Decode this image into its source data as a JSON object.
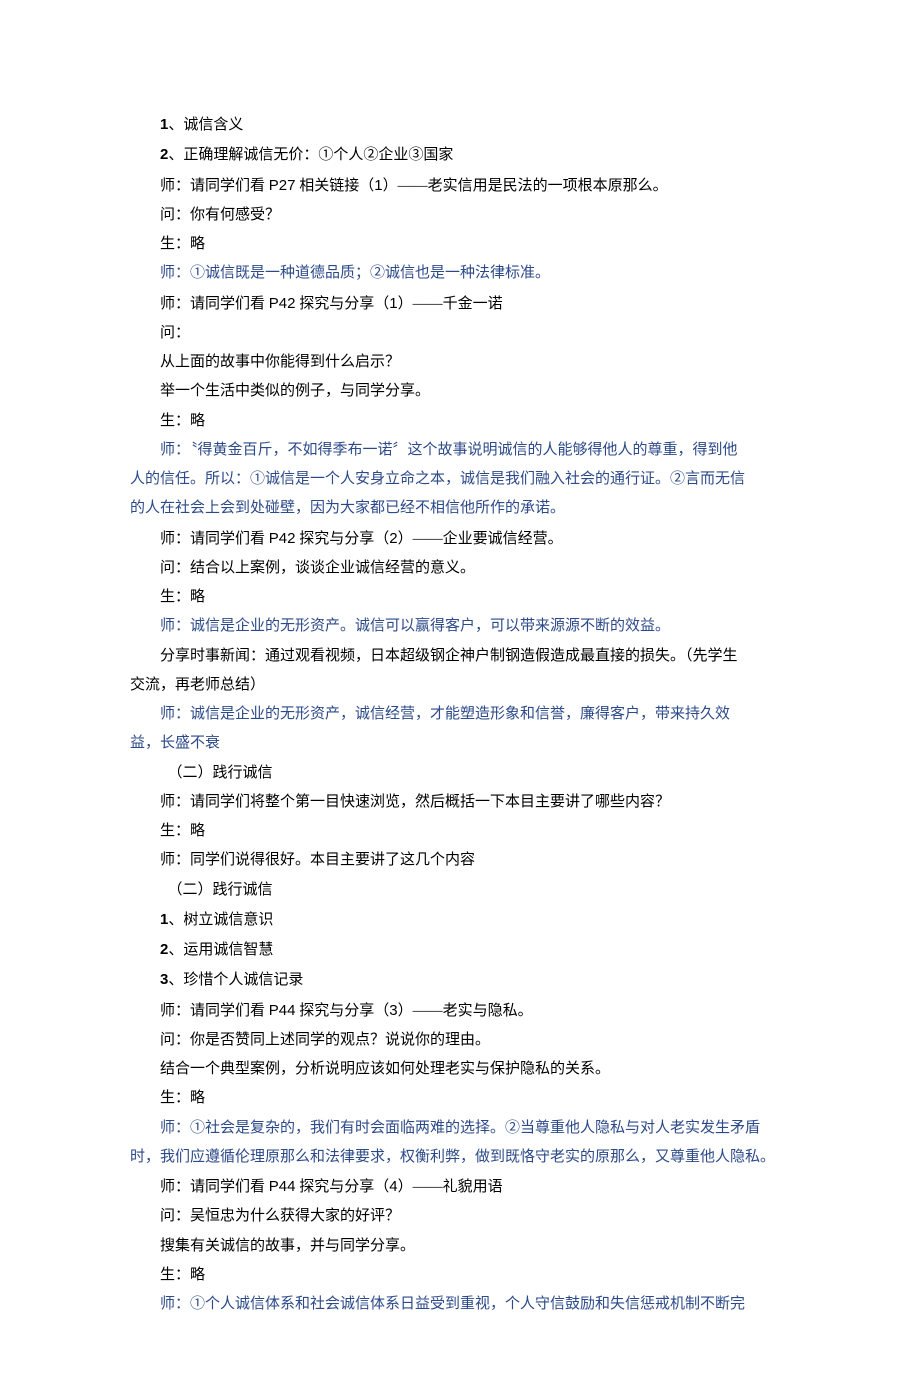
{
  "lines": [
    {
      "cls": "para",
      "segs": [
        {
          "t": "1",
          "c": "bold-num"
        },
        {
          "t": "、诚信含义"
        }
      ]
    },
    {
      "cls": "para",
      "segs": [
        {
          "t": "2",
          "c": "bold-num"
        },
        {
          "t": "、正确理解诚信无价：①个人②企业③国家"
        }
      ]
    },
    {
      "cls": "para",
      "segs": [
        {
          "t": "师：请同学们看 "
        },
        {
          "t": "P27",
          "c": "latin"
        },
        {
          "t": " 相关链接（"
        },
        {
          "t": "1",
          "c": "latin"
        },
        {
          "t": "）"
        },
        {
          "t": "——",
          "c": "dash"
        },
        {
          "t": "老实信用是民法的一项根本原那么。"
        }
      ]
    },
    {
      "cls": "para",
      "segs": [
        {
          "t": "问：你有何感受？"
        }
      ]
    },
    {
      "cls": "para",
      "segs": [
        {
          "t": "生：略"
        }
      ]
    },
    {
      "cls": "para blue",
      "segs": [
        {
          "t": "师：①诚信既是一种道德品质；②诚信也是一种法律标准。"
        }
      ]
    },
    {
      "cls": "para",
      "segs": [
        {
          "t": "师：请同学们看 "
        },
        {
          "t": "P42",
          "c": "latin"
        },
        {
          "t": " 探究与分享（"
        },
        {
          "t": "1",
          "c": "latin"
        },
        {
          "t": "）"
        },
        {
          "t": "——",
          "c": "dash"
        },
        {
          "t": "千金一诺"
        }
      ]
    },
    {
      "cls": "para",
      "segs": [
        {
          "t": "问："
        }
      ]
    },
    {
      "cls": "para",
      "segs": [
        {
          "t": "从上面的故事中你能得到什么启示？"
        }
      ]
    },
    {
      "cls": "para",
      "segs": [
        {
          "t": "举一个生活中类似的例子，与同学分享。"
        }
      ]
    },
    {
      "cls": "para",
      "segs": [
        {
          "t": "生：略"
        }
      ]
    },
    {
      "cls": "para blue",
      "segs": [
        {
          "t": "师：〝得黄金百斤，不如得季布一诺〞这个故事说明诚信的人能够得他人的尊重，得到他"
        }
      ]
    },
    {
      "cls": "blue",
      "segs": [
        {
          "t": "人的信任。所以：①诚信是一个人安身立命之本，诚信是我们融入社会的通行证。②言而无信"
        }
      ]
    },
    {
      "cls": "blue",
      "segs": [
        {
          "t": "的人在社会上会到处碰壁，因为大家都已经不相信他所作的承诺。"
        }
      ]
    },
    {
      "cls": "para",
      "segs": [
        {
          "t": "师：请同学们看 "
        },
        {
          "t": "P42",
          "c": "latin"
        },
        {
          "t": " 探究与分享（"
        },
        {
          "t": "2",
          "c": "latin"
        },
        {
          "t": "）"
        },
        {
          "t": "——",
          "c": "dash"
        },
        {
          "t": "企业要诚信经营。"
        }
      ]
    },
    {
      "cls": "para",
      "segs": [
        {
          "t": "问：结合以上案例，谈谈企业诚信经营的意义。"
        }
      ]
    },
    {
      "cls": "para",
      "segs": [
        {
          "t": "生：略"
        }
      ]
    },
    {
      "cls": "para blue",
      "segs": [
        {
          "t": "师：诚信是企业的无形资产。诚信可以赢得客户，可以带来源源不断的效益。"
        }
      ]
    },
    {
      "cls": "para",
      "segs": [
        {
          "t": "分享时事新闻：通过观看视频，日本超级钢企神户制钢造假造成最直接的损失。（先学生"
        }
      ]
    },
    {
      "cls": "",
      "segs": [
        {
          "t": "交流，再老师总结）"
        }
      ]
    },
    {
      "cls": "para blue",
      "segs": [
        {
          "t": "师：诚信是企业的无形资产，诚信经营，才能塑造形象和信誉，廉得客户，带来持久效"
        }
      ]
    },
    {
      "cls": "blue",
      "segs": [
        {
          "t": "益，长盛不衰"
        }
      ]
    },
    {
      "cls": "para",
      "segs": [
        {
          "t": "　（二）践行诚信"
        }
      ]
    },
    {
      "cls": "para",
      "segs": [
        {
          "t": "师：请同学们将整个第一目快速浏览，然后概括一下本目主要讲了哪些内容？"
        }
      ]
    },
    {
      "cls": "para",
      "segs": [
        {
          "t": "生：略"
        }
      ]
    },
    {
      "cls": "para",
      "segs": [
        {
          "t": "师：同学们说得很好。本目主要讲了这几个内容"
        }
      ]
    },
    {
      "cls": "para",
      "segs": [
        {
          "t": "　（二）践行诚信"
        }
      ]
    },
    {
      "cls": "para",
      "segs": [
        {
          "t": "1",
          "c": "bold-num"
        },
        {
          "t": "、树立诚信意识"
        }
      ]
    },
    {
      "cls": "para",
      "segs": [
        {
          "t": "2",
          "c": "bold-num"
        },
        {
          "t": "、运用诚信智慧"
        }
      ]
    },
    {
      "cls": "para",
      "segs": [
        {
          "t": "3",
          "c": "bold-num"
        },
        {
          "t": "、珍惜个人诚信记录"
        }
      ]
    },
    {
      "cls": "para",
      "segs": [
        {
          "t": "师：请同学们看 "
        },
        {
          "t": "P44",
          "c": "latin"
        },
        {
          "t": " 探究与分享（"
        },
        {
          "t": "3",
          "c": "latin"
        },
        {
          "t": "）"
        },
        {
          "t": "——",
          "c": "dash"
        },
        {
          "t": "老实与隐私。"
        }
      ]
    },
    {
      "cls": "para",
      "segs": [
        {
          "t": "问：你是否赞同上述同学的观点？说说你的理由。"
        }
      ]
    },
    {
      "cls": "para",
      "segs": [
        {
          "t": "结合一个典型案例，分析说明应该如何处理老实与保护隐私的关系。"
        }
      ]
    },
    {
      "cls": "para",
      "segs": [
        {
          "t": "生：略"
        }
      ]
    },
    {
      "cls": "para blue",
      "segs": [
        {
          "t": "师：①社会是复杂的，我们有时会面临两难的选择。②当尊重他人隐私与对人老实发生矛盾"
        }
      ]
    },
    {
      "cls": "blue",
      "segs": [
        {
          "t": "时，我们应遵循伦理原那么和法律要求，权衡利弊，做到既恪守老实的原那么，又尊重他人隐私。"
        }
      ]
    },
    {
      "cls": "para",
      "segs": [
        {
          "t": "师：请同学们看 "
        },
        {
          "t": "P44",
          "c": "latin"
        },
        {
          "t": " 探究与分享（"
        },
        {
          "t": "4",
          "c": "latin"
        },
        {
          "t": "）"
        },
        {
          "t": "——",
          "c": "dash"
        },
        {
          "t": "礼貌用语"
        }
      ]
    },
    {
      "cls": "para",
      "segs": [
        {
          "t": "问：吴恒忠为什么获得大家的好评？"
        }
      ]
    },
    {
      "cls": "para",
      "segs": [
        {
          "t": "搜集有关诚信的故事，并与同学分享。"
        }
      ]
    },
    {
      "cls": "para",
      "segs": [
        {
          "t": "生：略"
        }
      ]
    },
    {
      "cls": "para blue",
      "segs": [
        {
          "t": "师：①个人诚信体系和社会诚信体系日益受到重视，个人守信鼓励和失信惩戒机制不断完"
        }
      ]
    }
  ]
}
